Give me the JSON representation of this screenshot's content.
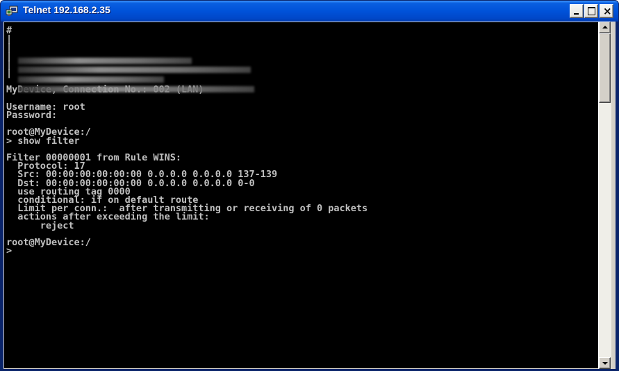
{
  "window": {
    "title": "Telnet 192.168.2.35",
    "close_glyph": "×",
    "icon": "telnet-app-icon",
    "title_color": "#0052d9"
  },
  "terminal": {
    "lines": [
      "#",
      "|",
      "|",
      "|",
      "|",
      "|",
      "",
      "MyDevice, Connection No.: 002 (LAN)",
      "",
      "Username: root",
      "Password:",
      "",
      "root@MyDevice:/",
      "> show filter",
      "",
      "Filter 00000001 from Rule WINS:",
      "  Protocol: 17",
      "  Src: 00:00:00:00:00:00 0.0.0.0 0.0.0.0 137-139",
      "  Dst: 00:00:00:00:00:00 0.0.0.0 0.0.0.0 0-0",
      "  use routing tag 0000",
      "  conditional: if on default route",
      "  Limit per conn.:  after transmitting or receiving of 0 packets",
      "  actions after exceeding the limit:",
      "      reject",
      "",
      "root@MyDevice:/",
      ">"
    ],
    "background": "#000000",
    "foreground": "#c0c0c0"
  }
}
